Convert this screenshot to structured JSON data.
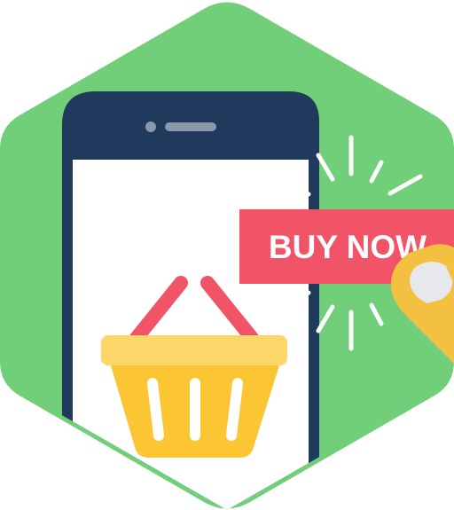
{
  "buy_button": {
    "label": "BUY NOW"
  },
  "colors": {
    "hexagon": "#71cf79",
    "phone_body": "#1f3a5c",
    "phone_screen": "#ffffff",
    "buy_button": "#f25467",
    "buy_text": "#ffffff",
    "basket": "#fbc534",
    "basket_rim": "#fdd66a",
    "basket_handle": "#f25467",
    "finger": "#f4c042",
    "nail": "#e6e8ec"
  },
  "icons": [
    "hexagon-badge-icon",
    "smartphone-icon",
    "shopping-basket-icon",
    "finger-tap-icon",
    "click-burst-icon"
  ]
}
